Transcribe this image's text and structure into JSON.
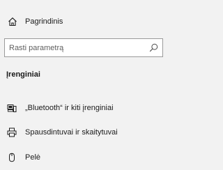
{
  "nav": {
    "home": {
      "label": "Pagrindinis",
      "icon": "home-icon"
    },
    "search": {
      "placeholder": "Rasti parametrą",
      "value": "",
      "icon": "search-icon"
    },
    "section_heading": "Įrenginiai",
    "items": [
      {
        "label": "„Bluetooth“ ir kiti įrenginiai",
        "icon": "bluetooth-devices-icon"
      },
      {
        "label": "Spausdintuvai ir skaitytuvai",
        "icon": "printer-icon"
      },
      {
        "label": "Pelė",
        "icon": "mouse-icon"
      }
    ]
  }
}
